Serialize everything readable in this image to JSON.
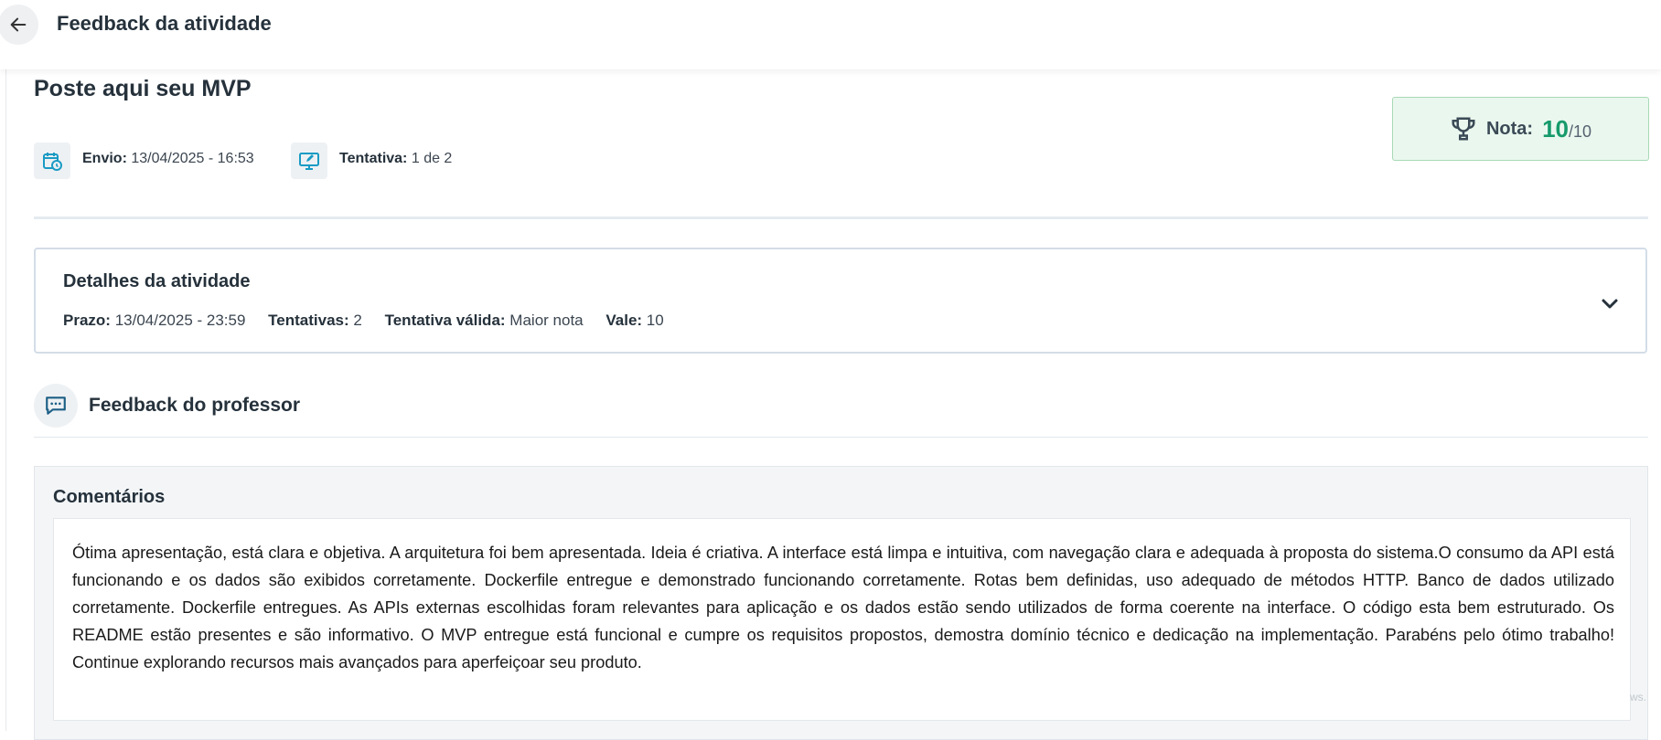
{
  "header": {
    "title": "Feedback da atividade"
  },
  "activity": {
    "title": "Poste aqui seu MVP",
    "submission_label": "Envio:",
    "submission_value": "13/04/2025 - 16:53",
    "attempt_label": "Tentativa:",
    "attempt_value": "1 de 2"
  },
  "grade": {
    "label": "Nota:",
    "value": "10",
    "max": "/10"
  },
  "details": {
    "title": "Detalhes da atividade",
    "deadline_label": "Prazo:",
    "deadline_value": "13/04/2025 - 23:59",
    "attempts_label": "Tentativas:",
    "attempts_value": "2",
    "valid_label": "Tentativa válida:",
    "valid_value": "Maior nota",
    "worth_label": "Vale:",
    "worth_value": "10"
  },
  "feedback": {
    "title": "Feedback do professor",
    "comments_title": "Comentários",
    "comments_text": "Ótima apresentação, está clara e objetiva. A arquitetura foi bem apresentada. Ideia é criativa. A interface está limpa e intuitiva, com navegação clara e adequada à proposta do sistema.O consumo da API está funcionando e os dados são exibidos corretamente. Dockerfile entregue e demonstrado funcionando corretamente. Rotas bem definidas, uso adequado de métodos HTTP. Banco de dados utilizado corretamente. Dockerfile entregues. As APIs externas escolhidas foram relevantes para aplicação e os dados estão sendo utilizados de forma coerente na interface. O código esta bem estruturado. Os README estão presentes e são informativo. O MVP entregue está funcional e cumpre os requisitos propostos, demostra domínio técnico e dedicação na implementação. Parabéns pelo ótimo trabalho! Continue explorando recursos mais avançados para aperfeiçoar seu produto."
  },
  "watermark": "ws.",
  "icons": {
    "back": "arrow-left-icon",
    "submission": "calendar-clock-icon",
    "attempt": "monitor-edit-icon",
    "grade": "trophy-icon",
    "expand": "chevron-down-icon",
    "feedback": "chat-bubble-icon"
  },
  "colors": {
    "accent": "#169a6c",
    "icon": "#1a9bc4",
    "grade_bg": "#eaf7ee"
  }
}
